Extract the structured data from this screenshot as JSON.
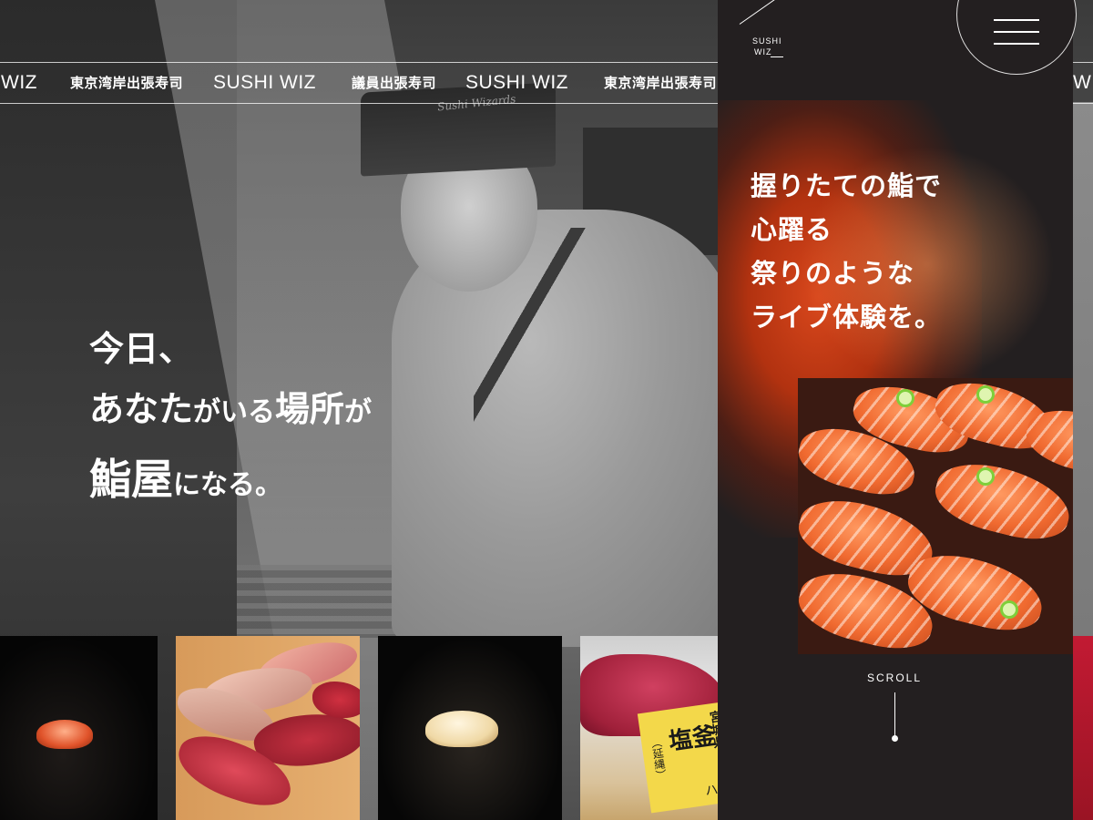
{
  "brand": {
    "logo_line1": "SUSHI",
    "logo_line2": "WIZ"
  },
  "marquee": {
    "items": [
      "WIZ",
      "東京湾岸出張寿司",
      "SUSHI WIZ",
      "議員出張寿司",
      "SUSHI WIZ",
      "東京湾岸出張寿司",
      "WIZ"
    ]
  },
  "hero": {
    "chef_hat_text": "Sushi Wizards",
    "line1": "今日、",
    "line2_a": "あなた",
    "line2_b": "がいる",
    "line2_c": "場所",
    "line2_d": "が",
    "line3_a": "鮨屋",
    "line3_b": "になる。"
  },
  "panel": {
    "tagline": [
      "握りたての鮨で",
      "心躍る",
      "祭りのような",
      "ライブ体験を。"
    ],
    "scroll_label": "SCROLL"
  },
  "thumbnails": {
    "tag_big": "塩釜",
    "tag_side": "（延縄）",
    "tag_pref": "宮城県",
    "tag_sign": "ハゲ"
  },
  "colors": {
    "panel_bg": "#231f20",
    "accent_orange": "#d8471c",
    "text_white": "#ffffff"
  },
  "icons": {
    "menu": "hamburger-menu-icon"
  }
}
